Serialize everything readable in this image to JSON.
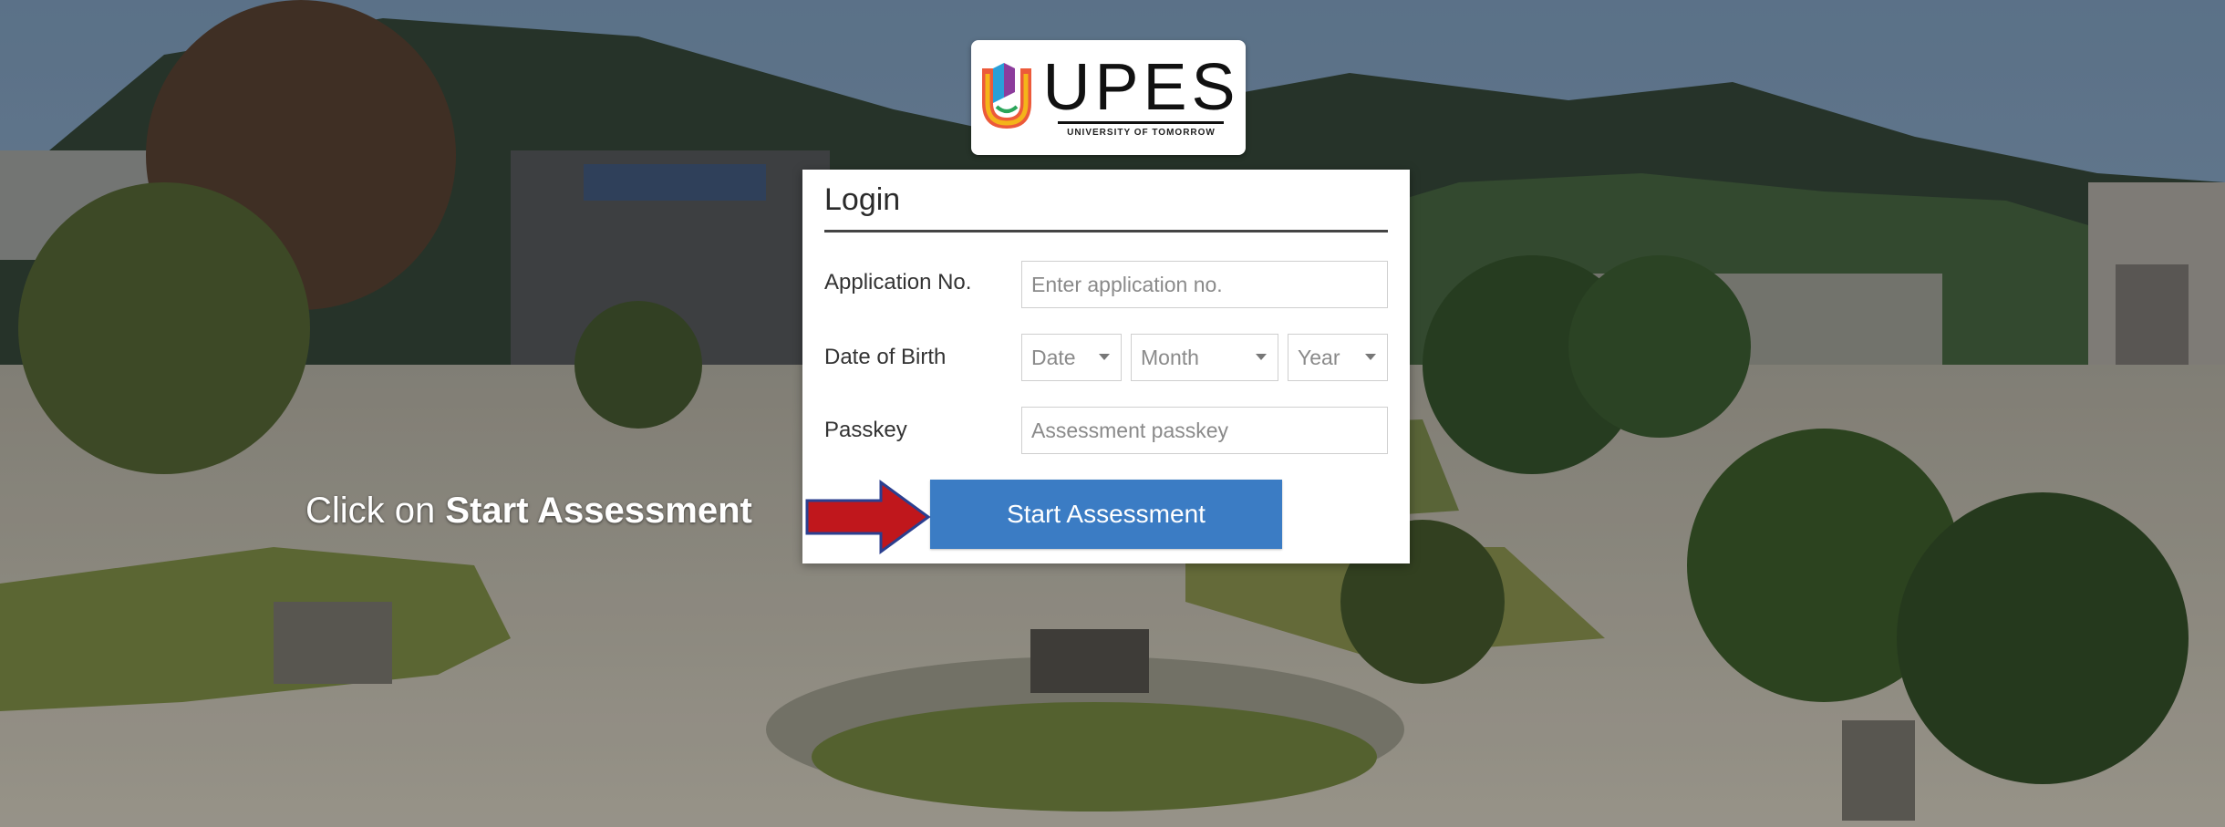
{
  "logo": {
    "wordmark": "UPES",
    "tagline": "UNIVERSITY OF TOMORROW"
  },
  "login": {
    "title": "Login",
    "application": {
      "label": "Application No.",
      "placeholder": "Enter application no.",
      "value": ""
    },
    "dob": {
      "label": "Date of Birth",
      "day": "Date",
      "month": "Month",
      "year": "Year"
    },
    "passkey": {
      "label": "Passkey",
      "placeholder": "Assessment passkey",
      "value": ""
    },
    "submit_label": "Start Assessment"
  },
  "instruction": {
    "prefix": "Click on ",
    "emphasis": "Start Assessment"
  },
  "colors": {
    "button": "#3b7cc4",
    "arrow": "#c0171c",
    "arrow_outline": "#2b3f8f"
  },
  "icons": {
    "arrow": "right-arrow-icon",
    "dropdown": "caret-down-icon"
  }
}
